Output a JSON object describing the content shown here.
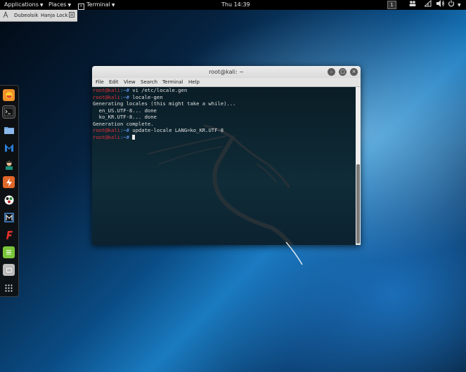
{
  "top_panel": {
    "applications": "Applications",
    "places": "Places",
    "terminal": "Terminal",
    "clock": "Thu 14:39",
    "workspace": "1"
  },
  "secondary_bar": {
    "app1": "Dubeolsik",
    "app2": "Hanja Lock"
  },
  "dock": {
    "items": [
      "firefox-icon",
      "terminal-icon",
      "files-icon",
      "maltego-icon",
      "avatar-icon",
      "burpsuite-icon",
      "armitage-icon",
      "metasploit-icon",
      "faraday-icon",
      "leafpad-icon",
      "greenbone-icon",
      "show-apps-icon"
    ]
  },
  "window": {
    "title": "root@kali: ~",
    "menu": [
      "File",
      "Edit",
      "View",
      "Search",
      "Terminal",
      "Help"
    ],
    "lines": [
      {
        "user": "root@kali",
        "path": ":~#",
        "cmd": " vi /etc/locale.gen"
      },
      {
        "user": "root@kali",
        "path": ":~#",
        "cmd": " locale-gen"
      },
      {
        "text": "Generating locales (this might take a while)..."
      },
      {
        "text": "  en_US.UTF-8... done"
      },
      {
        "text": "  ko_KR.UTF-8... done"
      },
      {
        "text": "Generation complete."
      },
      {
        "user": "root@kali",
        "path": ":~#",
        "cmd": " update-locale LANG=ko_KR.UTF-8"
      },
      {
        "user": "root@kali",
        "path": ":~#",
        "cmd": " "
      }
    ]
  },
  "colors": {
    "prompt_user": "#e0303a",
    "prompt_path": "#6aa0ff"
  }
}
